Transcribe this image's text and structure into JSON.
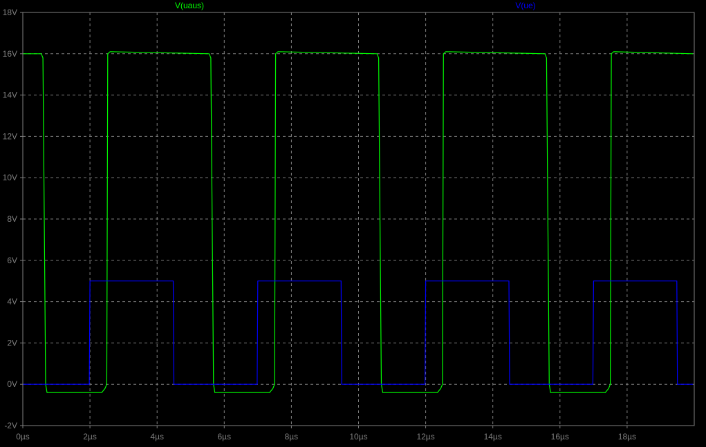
{
  "chart_data": {
    "type": "line",
    "title": "",
    "xlabel": "",
    "ylabel": "",
    "xlim": [
      0,
      20
    ],
    "ylim": [
      -2,
      18
    ],
    "grid": true,
    "x_ticks": [
      0,
      2,
      4,
      6,
      8,
      10,
      12,
      14,
      16,
      18
    ],
    "x_tick_labels": [
      "0µs",
      "2µs",
      "4µs",
      "6µs",
      "8µs",
      "10µs",
      "12µs",
      "14µs",
      "16µs",
      "18µs"
    ],
    "y_ticks": [
      -2,
      0,
      2,
      4,
      6,
      8,
      10,
      12,
      14,
      16,
      18
    ],
    "y_tick_labels": [
      "-2V",
      "0V",
      "2V",
      "4V",
      "6V",
      "8V",
      "10V",
      "12V",
      "14V",
      "16V",
      "18V"
    ],
    "legend_placement": "top",
    "series": [
      {
        "name": "V(uaus)",
        "color": "#00ff00",
        "x": [
          0,
          0.55,
          0.6,
          0.68,
          0.72,
          2.35,
          2.45,
          2.5,
          2.53,
          2.6,
          5.55,
          5.6,
          5.68,
          5.72,
          7.35,
          7.45,
          7.5,
          7.53,
          7.6,
          10.55,
          10.6,
          10.68,
          10.72,
          12.35,
          12.45,
          12.5,
          12.53,
          12.6,
          15.55,
          15.6,
          15.68,
          15.72,
          17.35,
          17.45,
          17.5,
          17.53,
          17.6,
          19.96
        ],
        "y": [
          16,
          16,
          15.8,
          0,
          -0.4,
          -0.4,
          -0.2,
          0,
          16,
          16.1,
          16.0,
          15.8,
          0,
          -0.4,
          -0.4,
          -0.2,
          0,
          16,
          16.1,
          16.0,
          15.8,
          0,
          -0.4,
          -0.4,
          -0.2,
          0,
          16,
          16.1,
          16.0,
          15.8,
          0,
          -0.4,
          -0.4,
          -0.2,
          0,
          16,
          16.1,
          16.0
        ]
      },
      {
        "name": "V(ue)",
        "color": "#0000ff",
        "x": [
          0,
          1.98,
          2.0,
          4.48,
          4.5,
          6.98,
          7.0,
          9.48,
          9.5,
          11.98,
          12.0,
          14.48,
          14.5,
          16.98,
          17.0,
          19.48,
          19.5,
          19.96
        ],
        "y": [
          0,
          0,
          5,
          5,
          0,
          0,
          5,
          5,
          0,
          0,
          5,
          5,
          0,
          0,
          5,
          5,
          0,
          0
        ]
      }
    ]
  },
  "style": {
    "background": "#000000",
    "axis_color": "#808080",
    "grid_color": "#808080",
    "tick_label_color": "#808080"
  }
}
